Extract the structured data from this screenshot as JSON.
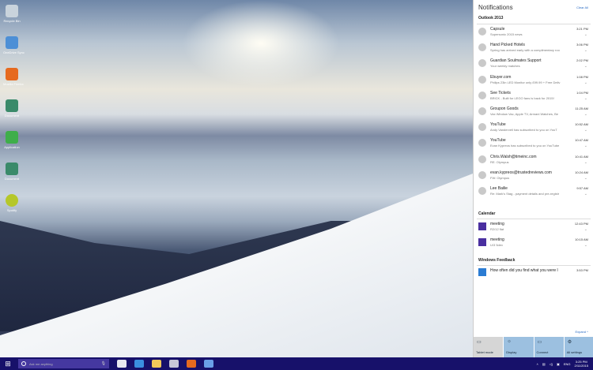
{
  "desktop": {
    "icons": [
      {
        "label": "Recycle Bin",
        "color": "#c9d3dc"
      },
      {
        "label": "OneDrive Sync",
        "color": "#4d8fd6"
      },
      {
        "label": "Mozilla Firefox",
        "color": "#e66a1f"
      },
      {
        "label": "Document",
        "color": "#3a8a6a"
      },
      {
        "label": "Application",
        "color": "#3fae4a"
      },
      {
        "label": "Document",
        "color": "#3a8a6a"
      },
      {
        "label": "Spotify",
        "color": "#b5c72a"
      }
    ]
  },
  "panel": {
    "title": "Notifications",
    "clear_all": "Clear All",
    "expand": "Expand ^",
    "outlook": {
      "header": "Outlook 2013",
      "items": [
        {
          "title": "Capsule",
          "sub": "Supersonic 2015 news",
          "time": "3:21 PM"
        },
        {
          "title": "Hand Picked Hotels",
          "sub": "Spring has arrived early with a complimentary roo",
          "time": "3:06 PM"
        },
        {
          "title": "Guardian Soulmates Support",
          "sub": "Your weekly matches",
          "time": "2:02 PM"
        },
        {
          "title": "Ebuyer.com",
          "sub": "Philips 23in LED Monitor only £99.99 + Free Deliv",
          "time": "1:08 PM"
        },
        {
          "title": "See Tickets",
          "sub": "BRICK - Built for LEGO fans is back for 2015!",
          "time": "1:04 PM"
        },
        {
          "title": "Groupon Goods",
          "sub": "Vax Window Vac, Apple TV, Armani Watches, Be",
          "time": "11:25 AM"
        },
        {
          "title": "YouTube",
          "sub": "Andy Vandervell has subscribed to you on YouT",
          "time": "10:52 AM"
        },
        {
          "title": "YouTube",
          "sub": "Evan Kypreos has subscribed to you on YouTube",
          "time": "10:47 AM"
        },
        {
          "title": "Chris.Walsh@timeinc.com",
          "sub": "RE: Olympus",
          "time": "10:41 AM"
        },
        {
          "title": "evan.kypreos@trustedreviews.com",
          "sub": "FW: Olympus",
          "time": "10:24 AM"
        },
        {
          "title": "Lee Bailie",
          "sub": "Re: Mark's Stag - payment details and pre-registr",
          "time": "9:57 AM"
        }
      ]
    },
    "calendar": {
      "header": "Calendar",
      "items": [
        {
          "title": "meeting",
          "sub": "R2/12 flat",
          "time": "12:43 PM"
        },
        {
          "title": "meeting",
          "sub": "U/3 5dev",
          "time": "10:15 AM"
        }
      ]
    },
    "feedback": {
      "header": "Windows Feedback",
      "items": [
        {
          "title": "How often did you find what you were l",
          "time": "3:53 PM"
        }
      ]
    },
    "quick_actions": [
      {
        "label": "Tablet mode",
        "icon": "▭"
      },
      {
        "label": "Display",
        "icon": "☼"
      },
      {
        "label": "Connect",
        "icon": "▭"
      },
      {
        "label": "All settings",
        "icon": "⚙"
      }
    ]
  },
  "taskbar": {
    "search_placeholder": "Ask me anything",
    "lang": "ENG",
    "time": "3:25 PM",
    "date": "2/11/2015",
    "apps": [
      {
        "name": "task-view",
        "color": "#e8e8f0"
      },
      {
        "name": "edge",
        "color": "#3a8fe0"
      },
      {
        "name": "explorer",
        "color": "#f0c85a"
      },
      {
        "name": "store",
        "color": "#c8c8d8"
      },
      {
        "name": "firefox",
        "color": "#e66a1f"
      },
      {
        "name": "app",
        "color": "#6aa0e8"
      }
    ]
  }
}
